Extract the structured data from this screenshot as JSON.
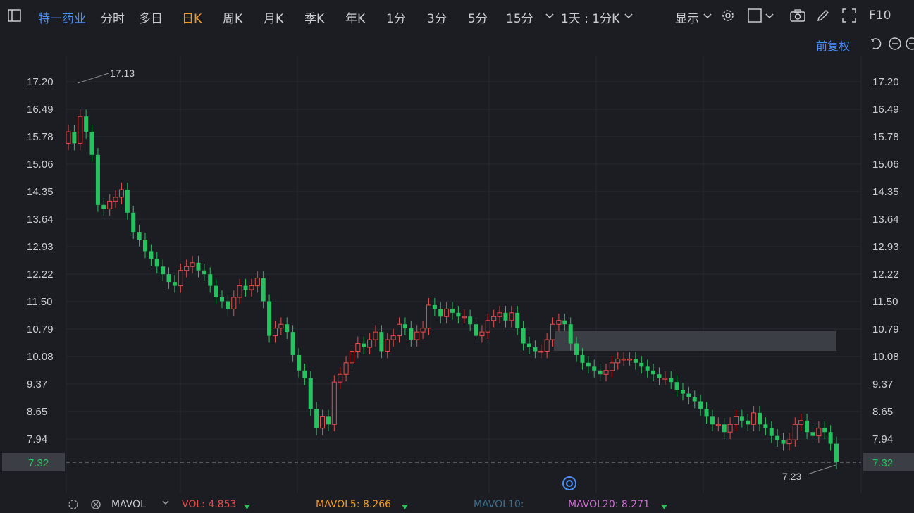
{
  "toolbar": {
    "symbol": "特一药业",
    "periods": [
      "分时",
      "多日",
      "日K",
      "周K",
      "月K",
      "季K",
      "年K",
      "1分",
      "3分",
      "5分",
      "15分"
    ],
    "active_period": "日K",
    "interval_label": "1天 : 1分K",
    "display_label": "显示",
    "f10_label": "F10",
    "adjust_label": "前复权"
  },
  "chart": {
    "y_ticks": [
      "17.20",
      "16.49",
      "15.78",
      "15.06",
      "14.35",
      "13.64",
      "12.93",
      "12.22",
      "11.50",
      "10.79",
      "10.08",
      "9.37",
      "8.65",
      "7.94"
    ],
    "current_price": "7.32",
    "high_label": "17.13",
    "low_label": "7.23",
    "colors": {
      "up": "#e94b4b",
      "down": "#27c25f",
      "background": "#1b1d22"
    }
  },
  "chart_data": {
    "type": "candlestick",
    "ylim": [
      7.0,
      17.7
    ],
    "max_price": 17.13,
    "min_price": 7.23,
    "last_price": 7.32,
    "gap_zone": [
      10.2,
      10.7
    ],
    "close": [
      15.9,
      15.6,
      16.3,
      15.9,
      15.3,
      14.0,
      13.9,
      14.1,
      14.2,
      14.4,
      13.8,
      13.3,
      13.1,
      12.8,
      12.6,
      12.4,
      12.2,
      12.0,
      11.9,
      12.3,
      12.4,
      12.5,
      12.3,
      12.2,
      11.9,
      11.6,
      11.5,
      11.3,
      11.6,
      11.9,
      11.8,
      11.9,
      12.1,
      11.5,
      10.6,
      10.8,
      10.9,
      10.7,
      10.1,
      9.7,
      9.5,
      8.7,
      8.2,
      8.5,
      8.3,
      9.4,
      9.6,
      9.9,
      10.2,
      10.4,
      10.3,
      10.5,
      10.7,
      10.2,
      10.5,
      10.6,
      10.9,
      10.8,
      10.5,
      10.7,
      10.8,
      11.4,
      11.3,
      11.1,
      11.3,
      11.2,
      11.1,
      11.1,
      10.9,
      10.6,
      10.7,
      11.0,
      11.1,
      11.2,
      11.0,
      11.2,
      10.8,
      10.4,
      10.3,
      10.2,
      10.2,
      10.5,
      10.9,
      11.0,
      10.9,
      10.4,
      10.1,
      9.9,
      9.8,
      9.7,
      9.6,
      9.7,
      9.9,
      10.0,
      10.0,
      10.0,
      9.9,
      9.8,
      9.7,
      9.6,
      9.5,
      9.5,
      9.4,
      9.2,
      9.1,
      9.0,
      8.9,
      8.7,
      8.5,
      8.3,
      8.3,
      8.1,
      8.3,
      8.5,
      8.4,
      8.3,
      8.6,
      8.3,
      8.2,
      8.0,
      7.9,
      7.8,
      7.9,
      8.3,
      8.4,
      8.1,
      8.0,
      8.2,
      8.1,
      7.8,
      7.32
    ],
    "open": [
      15.6,
      15.9,
      15.6,
      16.3,
      15.9,
      15.3,
      14.0,
      13.9,
      14.1,
      14.2,
      14.4,
      13.8,
      13.3,
      13.1,
      12.8,
      12.6,
      12.4,
      12.2,
      12.0,
      11.9,
      12.3,
      12.4,
      12.5,
      12.3,
      12.2,
      11.9,
      11.6,
      11.5,
      11.3,
      11.6,
      11.9,
      11.8,
      11.9,
      12.1,
      11.5,
      10.6,
      10.8,
      10.9,
      10.7,
      10.1,
      9.7,
      9.5,
      8.7,
      8.2,
      8.5,
      8.3,
      9.4,
      9.6,
      9.9,
      10.2,
      10.4,
      10.3,
      10.5,
      10.7,
      10.2,
      10.5,
      10.6,
      10.9,
      10.8,
      10.5,
      10.7,
      10.8,
      11.4,
      11.3,
      11.1,
      11.3,
      11.2,
      11.1,
      11.1,
      10.9,
      10.6,
      10.7,
      11.0,
      11.1,
      11.2,
      11.0,
      11.2,
      10.8,
      10.4,
      10.3,
      10.2,
      10.2,
      10.5,
      10.9,
      11.0,
      10.9,
      10.4,
      10.1,
      9.9,
      9.8,
      9.7,
      9.6,
      9.7,
      9.9,
      10.0,
      10.0,
      10.0,
      9.9,
      9.8,
      9.7,
      9.6,
      9.5,
      9.5,
      9.4,
      9.2,
      9.1,
      9.0,
      8.9,
      8.7,
      8.5,
      8.3,
      8.3,
      8.1,
      8.3,
      8.5,
      8.4,
      8.3,
      8.6,
      8.3,
      8.2,
      8.0,
      7.9,
      7.8,
      7.9,
      8.3,
      8.4,
      8.1,
      8.0,
      8.2,
      8.1,
      7.8
    ]
  },
  "indicators": {
    "name": "MAVOL",
    "vol": "VOL: 4.853",
    "mavol5": "MAVOL5: 8.266",
    "mavol10": "MAVOL10:",
    "mavol20": "MAVOL20: 8.271"
  }
}
